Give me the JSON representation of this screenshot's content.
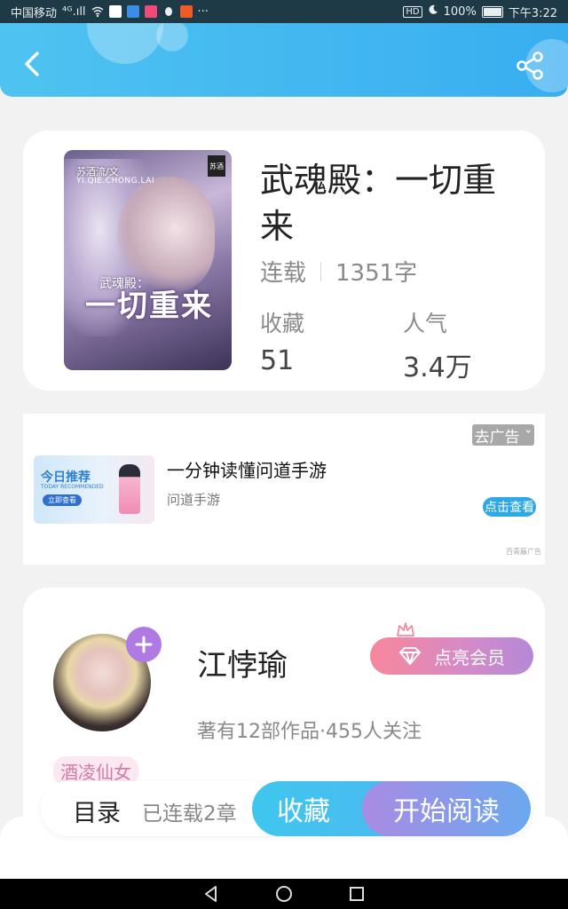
{
  "status_bar": {
    "carrier": "中国移动",
    "signal": "⁴ᴳ.ıll",
    "more": "···",
    "hd": "HD",
    "battery": "100%",
    "time": "下午3:22"
  },
  "header": {
    "back_icon": "chevron-left-icon",
    "share_icon": "share-icon"
  },
  "book": {
    "title": "武魂殿：一切重来",
    "status": "连载",
    "word_count": "1351字",
    "favorites_label": "收藏",
    "favorites_value": "51",
    "popularity_label": "人气",
    "popularity_value": "3.4万",
    "cover": {
      "title": "一切重来",
      "subtitle": "武魂殿：",
      "author": "苏酒流/文",
      "pinyin": "YI.QIE.CHONG.LAI",
      "badge": "苏酒"
    }
  },
  "ad": {
    "close_label": "去广告 ˇ",
    "title": "一分钟读懂问道手游",
    "source": "问道手游",
    "action_label": "点击查看",
    "ad_label": "百青藤广告",
    "image": {
      "title": "今日推荐",
      "subtitle": "TODAY RECOMMENDED",
      "button": "立即查看"
    }
  },
  "author": {
    "name": "江悖瑜",
    "follow_icon": "plus-icon",
    "vip_label": "点亮会员",
    "stats": "著有12部作品·455人关注",
    "tag": "酒凌仙女"
  },
  "bottom": {
    "toc_label": "目录",
    "chapter_info": "已连载2章",
    "collect_label": "收藏",
    "read_label": "开始阅读"
  },
  "colors": {
    "header": "#38aef0",
    "accent_blue": "#3fc7ee",
    "accent_purple": "#a98be3",
    "vip_pink": "#f8879b"
  }
}
